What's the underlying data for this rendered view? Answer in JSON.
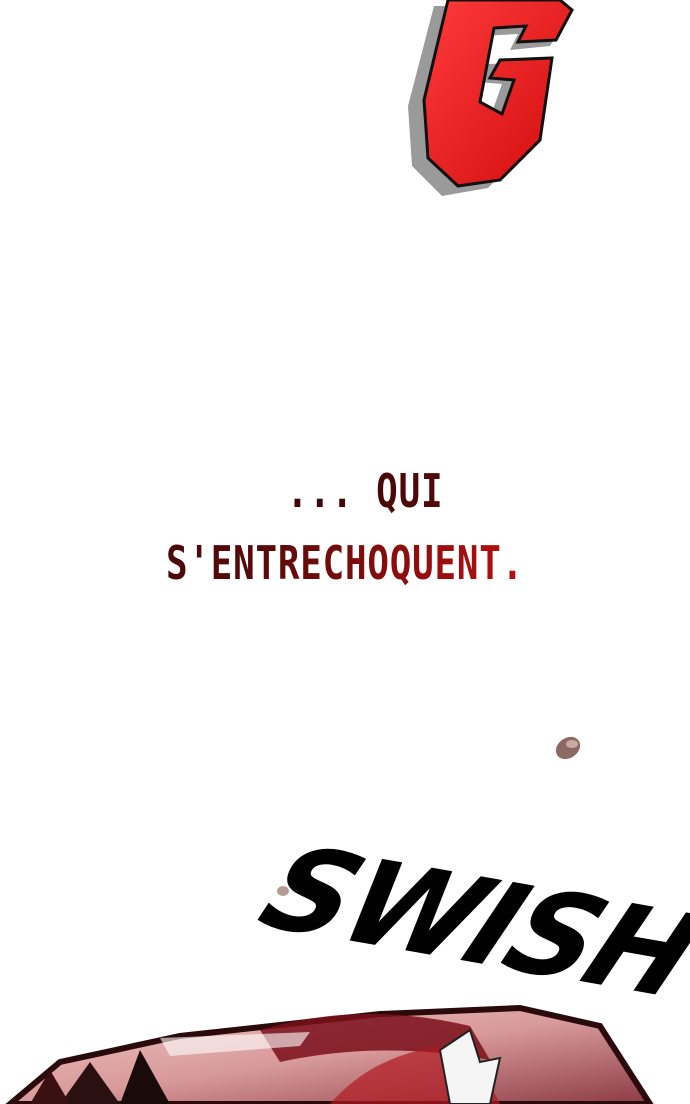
{
  "panel": {
    "sfx_top": "G",
    "caption_line_1": "... QUI",
    "caption_line_2": "S'ENTRECHOQUENT.",
    "sfx_bottom": "SWISH"
  },
  "colors": {
    "sfx_red": "#e51414",
    "caption_dark": "#3a0606",
    "caption_bright": "#d21414",
    "sfx_black": "#000000",
    "skin": "#d89a9a"
  }
}
